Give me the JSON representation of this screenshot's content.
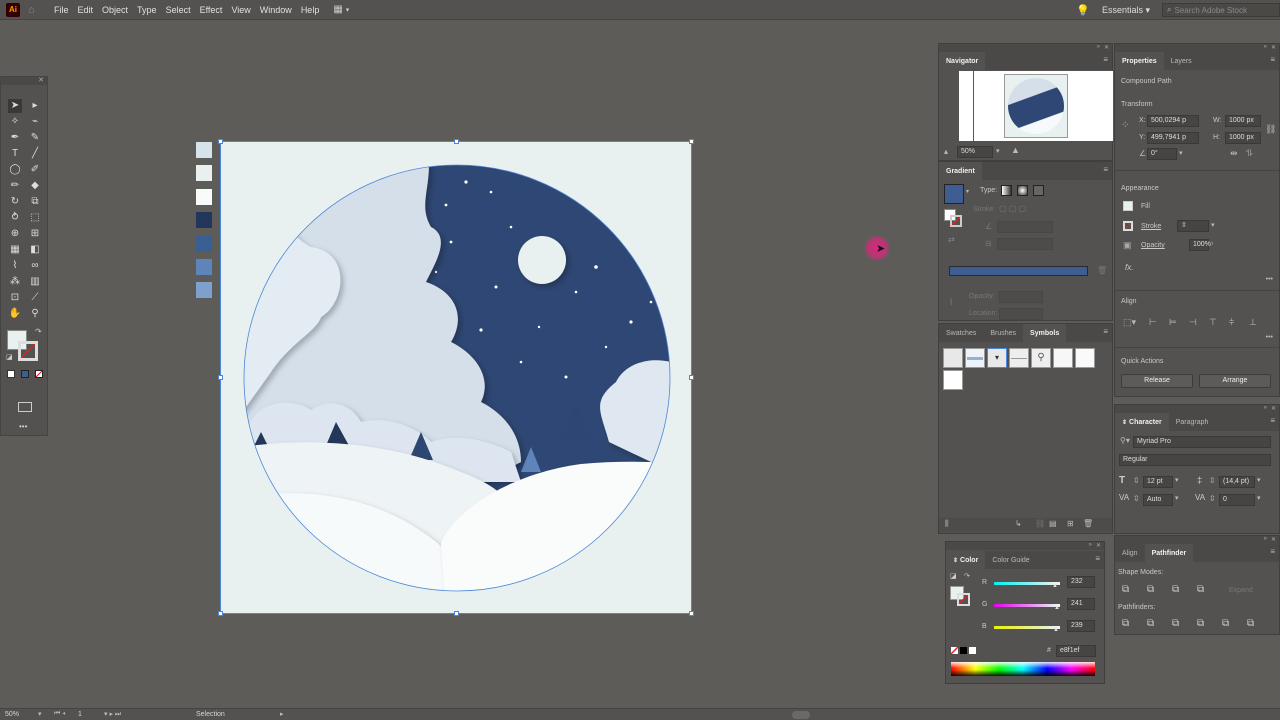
{
  "menubar": {
    "app_logo": "Ai",
    "items": [
      "File",
      "Edit",
      "Object",
      "Type",
      "Select",
      "Effect",
      "View",
      "Window",
      "Help"
    ],
    "workspace": "Essentials",
    "search_placeholder": "Search Adobe Stock"
  },
  "swatch_colors": [
    "#d6e2ec",
    "#e8f1ef",
    "#f9fbfb",
    "#23375a",
    "#3a5f93",
    "#5e84b9",
    "#7da0cc"
  ],
  "navigator": {
    "title": "Navigator",
    "zoom": "50%"
  },
  "gradient": {
    "title": "Gradient",
    "type_label": "Type:",
    "stroke_label": "Stroke:",
    "opacity_label": "Opacity:",
    "location_label": "Location:",
    "bar_color": "#3d5d93"
  },
  "symbols_panel": {
    "tabs": [
      "Swatches",
      "Brushes",
      "Symbols"
    ]
  },
  "properties": {
    "tabs": [
      "Properties",
      "Layers"
    ],
    "selection_type": "Compound Path",
    "transform_title": "Transform",
    "x_label": "X:",
    "x_value": "500,0294 p",
    "y_label": "Y:",
    "y_value": "499,7941 p",
    "w_label": "W:",
    "w_value": "1000 px",
    "h_label": "H:",
    "h_value": "1000 px",
    "angle_value": "0°",
    "appearance_title": "Appearance",
    "fill_label": "Fill",
    "stroke_label": "Stroke",
    "opacity_label": "Opacity",
    "opacity_value": "100%",
    "fx_label": "fx.",
    "align_title": "Align",
    "quick_actions_title": "Quick Actions",
    "release_label": "Release",
    "arrange_label": "Arrange"
  },
  "character": {
    "tabs": [
      "Character",
      "Paragraph"
    ],
    "font_family": "Myriad Pro",
    "font_style": "Regular",
    "size": "12 pt",
    "leading": "(14,4 pt)",
    "kerning": "Auto",
    "tracking": "0"
  },
  "pathfinder": {
    "tabs": [
      "Align",
      "Pathfinder"
    ],
    "shape_modes_label": "Shape Modes:",
    "pathfinders_label": "Pathfinders:",
    "expand_label": "Expand"
  },
  "color_panel": {
    "tabs": [
      "Color",
      "Color Guide"
    ],
    "r_label": "R",
    "r_value": "232",
    "g_label": "G",
    "g_value": "241",
    "b_label": "B",
    "b_value": "239",
    "hex_label": "#",
    "hex_value": "e8f1ef",
    "fill_color": "#e8f1ef"
  },
  "statusbar": {
    "zoom": "50%",
    "artboard_number": "1",
    "tool_name": "Selection"
  },
  "colors": {
    "canvas_bg": "#e8f1ef",
    "selection_blue": "#4d86d8",
    "night_sky": "#2e4673",
    "cursor_pink": "#e0257f"
  }
}
